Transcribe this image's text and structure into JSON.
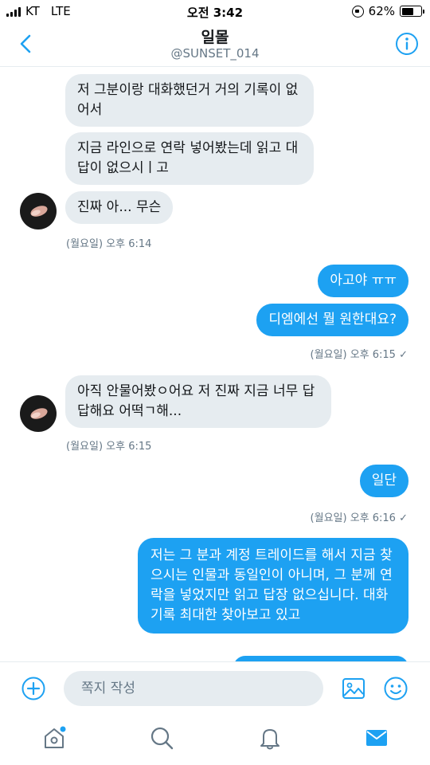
{
  "status_bar": {
    "carrier": "KT",
    "network": "LTE",
    "time": "오전 3:42",
    "battery_percent": "62%",
    "battery_level": 0.62
  },
  "header": {
    "title": "일몰",
    "handle": "@SUNSET_014",
    "back_icon": "chevron-left-icon",
    "info_icon": "info-icon"
  },
  "conversation": {
    "group1": {
      "messages": [
        "저 그분이랑 대화했던거 거의 기록이 없어서",
        "지금 라인으로 연락 넣어봤는데 읽고 대답이 없으시ㅣ고",
        "진짜 아... 무슨"
      ],
      "timestamp": "(월요일) 오후 6:14"
    },
    "group2": {
      "messages": [
        "아고야 ㅠㅠ",
        "디엠에선 뭘 원한대요?"
      ],
      "timestamp": "(월요일) 오후 6:15",
      "check": "✓"
    },
    "group3": {
      "messages": [
        "아직 안물어봤ㅇ어요 저 진짜 지금 너무 답답해요 어떡ㄱ해..."
      ],
      "timestamp": "(월요일) 오후 6:15"
    },
    "group4": {
      "messages": [
        "일단"
      ],
      "timestamp": "(월요일) 오후 6:16",
      "check": "✓"
    },
    "group5": {
      "messages": [
        "저는 그 분과 계정 트레이드를 해서 지금 찾으시는 인물과 동일인이 아니며, 그 분께 연락을 넣었지만 읽고 답장 없으십니다. 대화기록 최대한 찾아보고 있고"
      ]
    }
  },
  "composer": {
    "placeholder": "쪽지 작성",
    "add_icon": "plus-circle-icon",
    "image_icon": "image-icon",
    "emoji_icon": "smiley-icon"
  },
  "tabbar": {
    "items": [
      "home-icon",
      "search-icon",
      "notifications-icon",
      "messages-icon"
    ]
  },
  "colors": {
    "accent": "#1da1f2",
    "incoming_bubble": "#e6ecf0",
    "meta_text": "#657786"
  }
}
